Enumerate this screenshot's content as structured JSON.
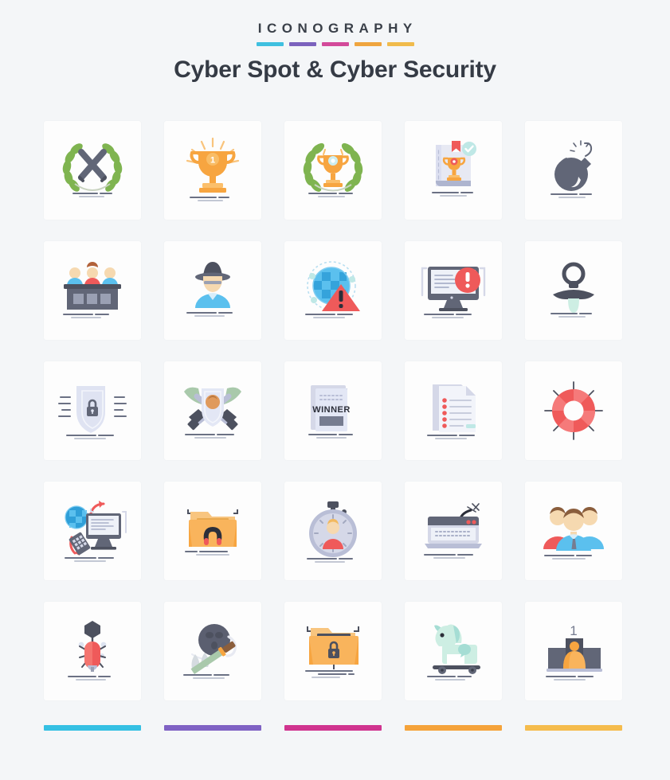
{
  "header": {
    "kicker": "ICONOGRAPHY",
    "title": "Cyber Spot & Cyber Security",
    "accent_dashes": [
      "#3fc0e0",
      "#7b62bd",
      "#d34a9a",
      "#efa53f",
      "#f0bb4c"
    ]
  },
  "footer": {
    "bars": [
      "#35c0e3",
      "#7f62c4",
      "#d0348f",
      "#f5a33a",
      "#f5bc4d"
    ]
  },
  "colors": {
    "page_background": "#f4f6f8",
    "card_background": "#fdfdfd",
    "title_text": "#353b45",
    "kicker_text": "#3a4049",
    "slate": "#616677",
    "slate_dark": "#4d515f",
    "lavender": "#d5d8e8",
    "lavender_light": "#e7e9f3",
    "gold": "#f7a540",
    "gold_light": "#fbbf6b",
    "red": "#ef5a5a",
    "red_dark": "#d9414a",
    "green": "#7fb450",
    "green_dark": "#6aa13e",
    "sky": "#5bc0ee",
    "sky_dark": "#2f9fd8",
    "mint": "#c9ece0",
    "skin": "#f6d9b0"
  },
  "grid": {
    "columns": 5,
    "rows": 5,
    "count": 25,
    "icons": [
      {
        "id": 1,
        "name": "laurel-wreath-swords-icon",
        "label": "Laurel Wreath With Crossed Swords"
      },
      {
        "id": 2,
        "name": "trophy-first-place-icon",
        "label": "Trophy First Place",
        "badge": "1"
      },
      {
        "id": 3,
        "name": "laurel-wreath-trophy-icon",
        "label": "Laurel Wreath With Trophy"
      },
      {
        "id": 4,
        "name": "certificate-trophy-icon",
        "label": "Award Certificate Verified"
      },
      {
        "id": 5,
        "name": "bomb-icon",
        "label": "Bomb"
      },
      {
        "id": 6,
        "name": "jury-panel-icon",
        "label": "Jury Panel"
      },
      {
        "id": 7,
        "name": "spy-hacker-icon",
        "label": "Spy With Hat"
      },
      {
        "id": 8,
        "name": "globe-warning-icon",
        "label": "Global Threat Warning"
      },
      {
        "id": 9,
        "name": "monitor-error-icon",
        "label": "Monitor System Alert"
      },
      {
        "id": 10,
        "name": "pacifier-icon",
        "label": "Pacifier"
      },
      {
        "id": 11,
        "name": "shield-lock-icon",
        "label": "Shield With Lock"
      },
      {
        "id": 12,
        "name": "shield-crossed-swords-icon",
        "label": "Shield With Crossed Swords"
      },
      {
        "id": 13,
        "name": "winner-poster-icon",
        "label": "Winner Poster",
        "badge": "WINNER"
      },
      {
        "id": 14,
        "name": "checklist-document-icon",
        "label": "Checklist Document"
      },
      {
        "id": 15,
        "name": "life-ring-icon",
        "label": "Life Ring Support"
      },
      {
        "id": 16,
        "name": "data-transfer-computer-icon",
        "label": "Computer Data Transfer"
      },
      {
        "id": 17,
        "name": "folder-magnet-icon",
        "label": "Folder With Magnet"
      },
      {
        "id": 18,
        "name": "stopwatch-user-icon",
        "label": "Stopwatch With User"
      },
      {
        "id": 19,
        "name": "browser-phishing-hook-icon",
        "label": "Browser Phishing Hook"
      },
      {
        "id": 20,
        "name": "team-group-icon",
        "label": "Team Group"
      },
      {
        "id": 21,
        "name": "bug-hammer-icon",
        "label": "Bug Being Crushed"
      },
      {
        "id": 22,
        "name": "bomb-sword-icon",
        "label": "Bomb With Sword"
      },
      {
        "id": 23,
        "name": "folder-lock-icon",
        "label": "Locked Folder"
      },
      {
        "id": 24,
        "name": "trojan-horse-icon",
        "label": "Trojan Horse"
      },
      {
        "id": 25,
        "name": "winner-podium-icon",
        "label": "Winner Podium",
        "badge": "1"
      }
    ]
  }
}
